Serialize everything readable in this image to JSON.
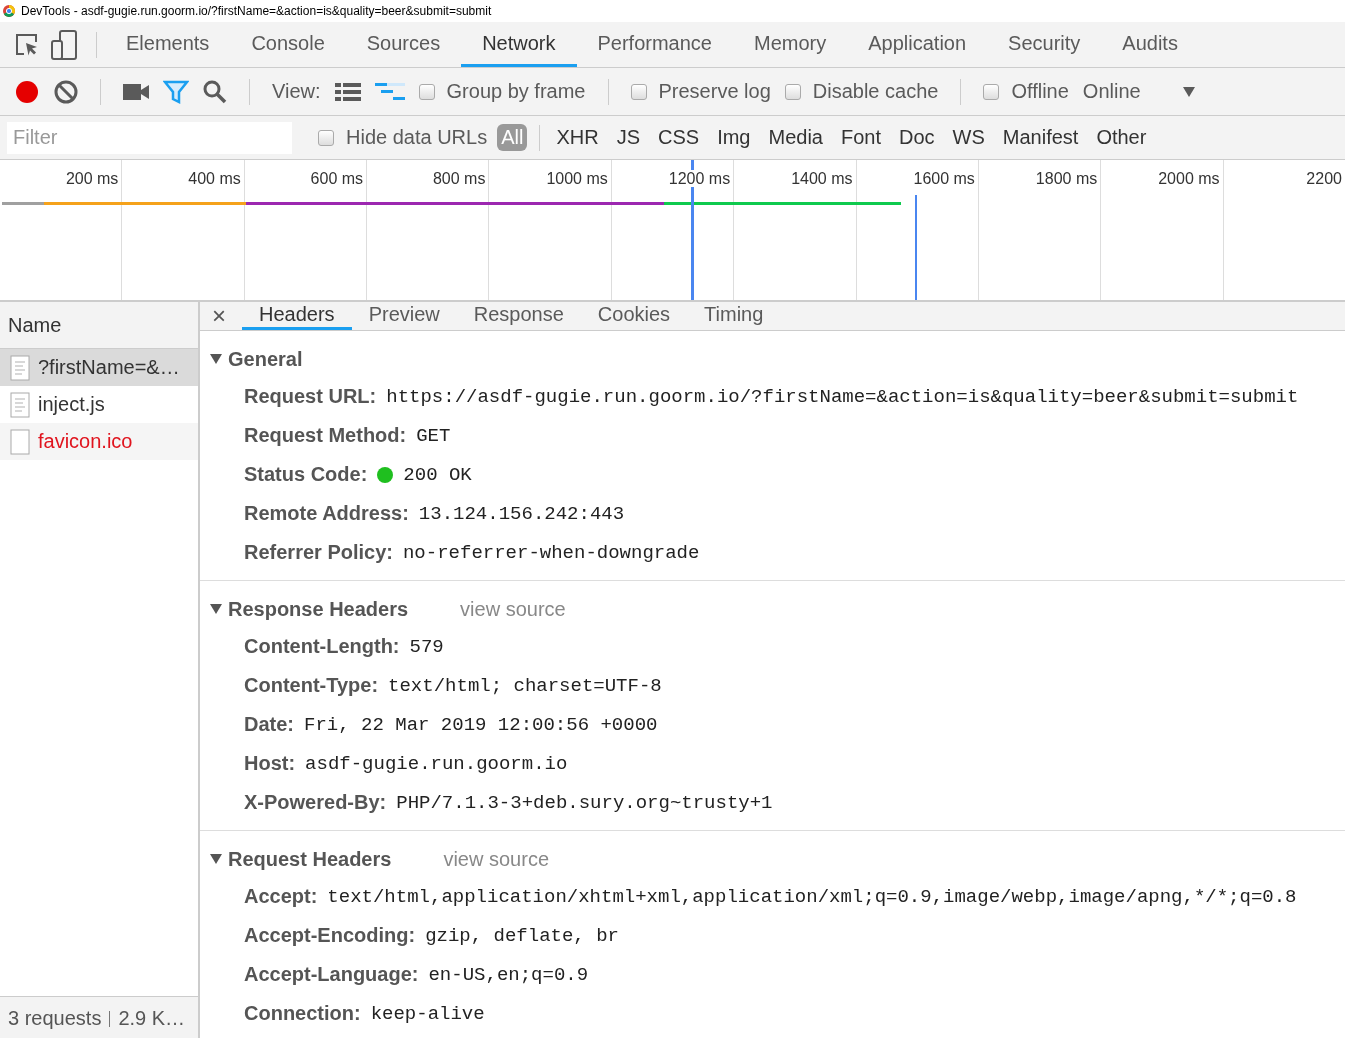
{
  "window": {
    "title": "DevTools - asdf-gugie.run.goorm.io/?firstName=&action=is&quality=beer&submit=submit"
  },
  "main_tabs": [
    {
      "label": "Elements",
      "selected": false
    },
    {
      "label": "Console",
      "selected": false
    },
    {
      "label": "Sources",
      "selected": false
    },
    {
      "label": "Network",
      "selected": true
    },
    {
      "label": "Performance",
      "selected": false
    },
    {
      "label": "Memory",
      "selected": false
    },
    {
      "label": "Application",
      "selected": false
    },
    {
      "label": "Security",
      "selected": false
    },
    {
      "label": "Audits",
      "selected": false
    }
  ],
  "toolbar": {
    "recording": true,
    "filter_on": true,
    "view_label": "View:",
    "view_modes": [
      {
        "kind": "list",
        "selected": false
      },
      {
        "kind": "waterfall",
        "selected": true
      }
    ],
    "options": [
      {
        "label": "Group by frame",
        "checked": false
      },
      {
        "label": "Preserve log",
        "checked": false
      },
      {
        "label": "Disable cache",
        "checked": false
      }
    ],
    "offline": {
      "label": "Offline",
      "checked": false
    },
    "throttling": "Online"
  },
  "filter_bar": {
    "placeholder": "Filter",
    "hide_data_urls": {
      "label": "Hide data URLs",
      "checked": false
    },
    "types": [
      {
        "label": "All",
        "selected": true
      },
      {
        "label": "XHR",
        "selected": false
      },
      {
        "label": "JS",
        "selected": false
      },
      {
        "label": "CSS",
        "selected": false
      },
      {
        "label": "Img",
        "selected": false
      },
      {
        "label": "Media",
        "selected": false
      },
      {
        "label": "Font",
        "selected": false
      },
      {
        "label": "Doc",
        "selected": false
      },
      {
        "label": "WS",
        "selected": false
      },
      {
        "label": "Manifest",
        "selected": false
      },
      {
        "label": "Other",
        "selected": false
      }
    ]
  },
  "timeline": {
    "ticks": [
      "200 ms",
      "400 ms",
      "600 ms",
      "800 ms",
      "1000 ms",
      "1200 ms",
      "1400 ms",
      "1600 ms",
      "1800 ms",
      "2000 ms",
      "2200"
    ]
  },
  "requests": {
    "column": "Name",
    "rows": [
      {
        "name": "?firstName=&…",
        "kind": "document",
        "selected": true,
        "failed": false
      },
      {
        "name": "inject.js",
        "kind": "document",
        "selected": false,
        "failed": false
      },
      {
        "name": "favicon.ico",
        "kind": "blank",
        "selected": false,
        "failed": true
      }
    ]
  },
  "status_bar": {
    "requests": "3 requests",
    "size": "2.9 K…"
  },
  "detail": {
    "close": "×",
    "tabs": [
      {
        "label": "Headers",
        "selected": true
      },
      {
        "label": "Preview",
        "selected": false
      },
      {
        "label": "Response",
        "selected": false
      },
      {
        "label": "Cookies",
        "selected": false
      },
      {
        "label": "Timing",
        "selected": false
      }
    ],
    "sections": [
      {
        "title": "General",
        "expanded": true,
        "rows": [
          {
            "key": "Request URL:",
            "value": "https://asdf-gugie.run.goorm.io/?firstName=&action=is&quality=beer&submit=submit"
          },
          {
            "key": "Request Method:",
            "value": "GET"
          },
          {
            "key": "Status Code:",
            "value": "200 OK",
            "color": "#1fbf1f"
          },
          {
            "key": "Remote Address:",
            "value": "13.124.156.242:443"
          },
          {
            "key": "Referrer Policy:",
            "value": "no-referrer-when-downgrade"
          }
        ]
      },
      {
        "title": "Response Headers",
        "expanded": true,
        "link": "view source",
        "rows": [
          {
            "key": "Content-Length:",
            "value": "579"
          },
          {
            "key": "Content-Type:",
            "value": "text/html; charset=UTF-8"
          },
          {
            "key": "Date:",
            "value": "Fri, 22 Mar 2019 12:00:56 +0000"
          },
          {
            "key": "Host:",
            "value": "asdf-gugie.run.goorm.io"
          },
          {
            "key": "X-Powered-By:",
            "value": "PHP/7.1.3-3+deb.sury.org~trusty+1"
          }
        ]
      },
      {
        "title": "Request Headers",
        "expanded": true,
        "link": "view source",
        "rows": [
          {
            "key": "Accept:",
            "value": "text/html,application/xhtml+xml,application/xml;q=0.9,image/webp,image/apng,*/*;q=0.8"
          },
          {
            "key": "Accept-Encoding:",
            "value": "gzip, deflate, br"
          },
          {
            "key": "Accept-Language:",
            "value": "en-US,en;q=0.9"
          },
          {
            "key": "Connection:",
            "value": "keep-alive"
          }
        ]
      }
    ]
  }
}
